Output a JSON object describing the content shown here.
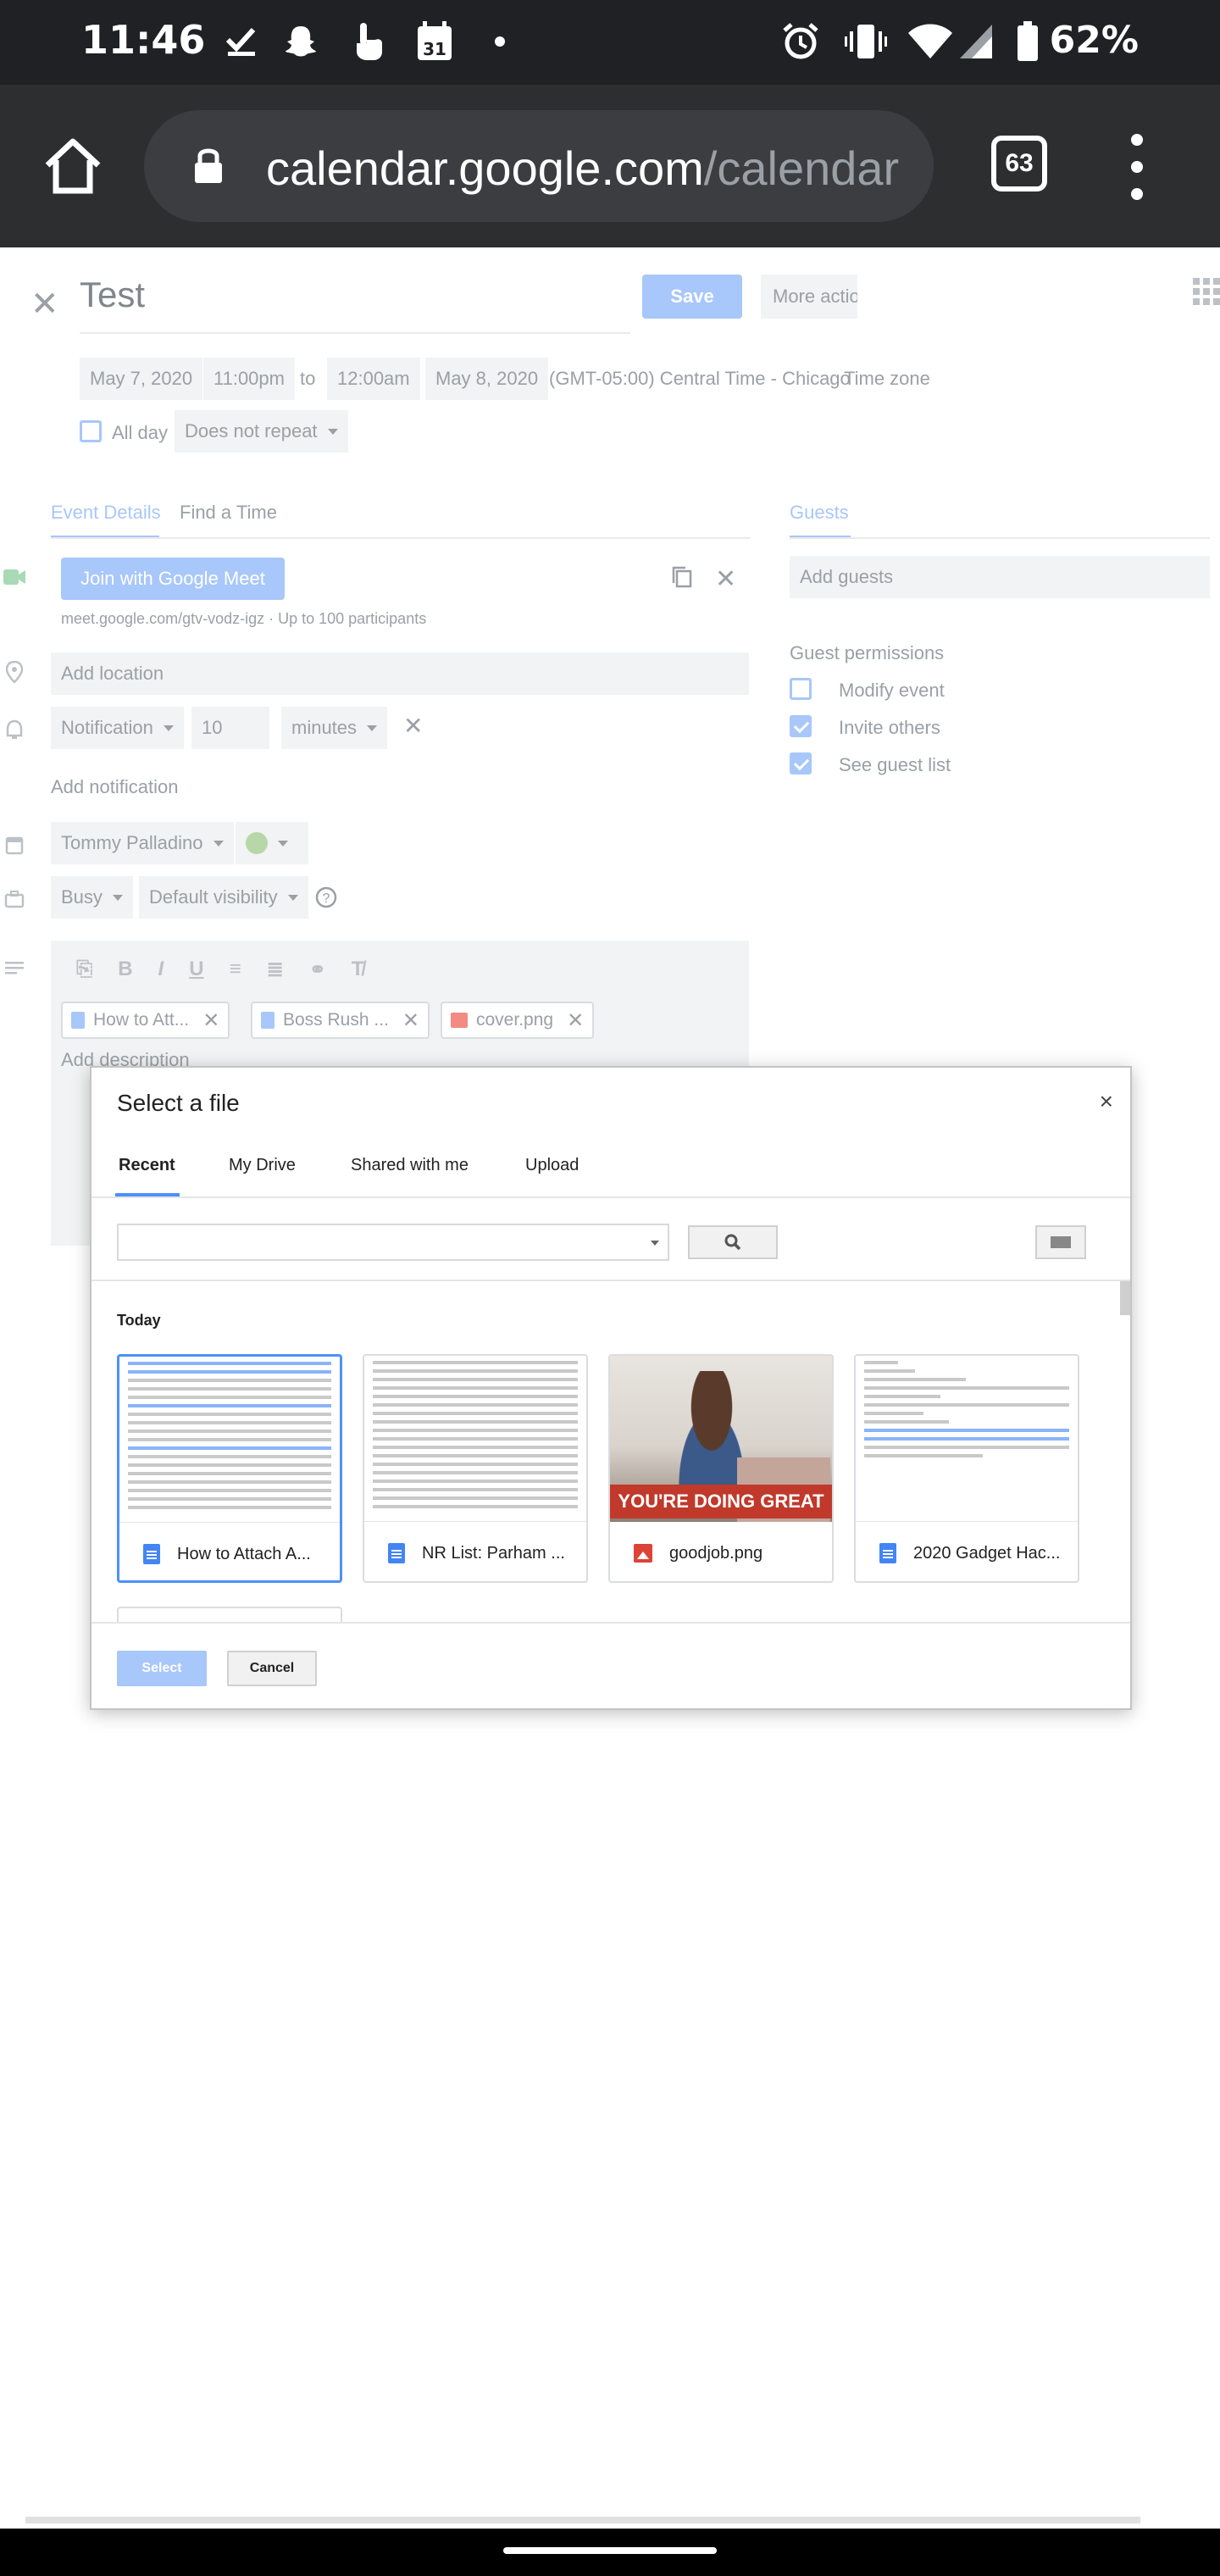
{
  "status_bar": {
    "time": "11:46",
    "battery": "62%",
    "tabs_count": "63",
    "calendar_icon_date": "31"
  },
  "browser": {
    "url_main": "calendar.google.com",
    "url_path": "/calendar"
  },
  "event": {
    "title": "Test",
    "save_label": "Save",
    "more_label": "More actio",
    "start_date": "May 7, 2020",
    "start_time": "11:00pm",
    "to_label": "to",
    "end_time": "12:00am",
    "end_date": "May 8, 2020",
    "timezone_value": "(GMT-05:00) Central Time - Chicago",
    "timezone_label": "Time zone",
    "all_day_label": "All day",
    "repeat_value": "Does not repeat",
    "tab_details": "Event Details",
    "tab_find_time": "Find a Time",
    "meet_button": "Join with Google Meet",
    "meet_link": "meet.google.com/gtv-vodz-igz · Up to 100 participants",
    "location_placeholder": "Add location",
    "notification_type": "Notification",
    "notification_value": "10",
    "notification_unit": "minutes",
    "add_notification": "Add notification",
    "calendar_owner": "Tommy Palladino",
    "busy_value": "Busy",
    "visibility_value": "Default visibility",
    "attachments": [
      {
        "name": "How to Att..."
      },
      {
        "name": "Boss Rush ..."
      },
      {
        "name": "cover.png"
      }
    ],
    "description_placeholder": "Add description"
  },
  "guests": {
    "tab_label": "Guests",
    "add_placeholder": "Add guests",
    "permissions_title": "Guest permissions",
    "permissions": [
      {
        "label": "Modify event",
        "checked": false
      },
      {
        "label": "Invite others",
        "checked": true
      },
      {
        "label": "See guest list",
        "checked": true
      }
    ]
  },
  "picker": {
    "title": "Select a file",
    "close": "×",
    "tabs": [
      "Recent",
      "My Drive",
      "Shared with me",
      "Upload"
    ],
    "section": "Today",
    "files": [
      {
        "name": "How to Attach A...",
        "type": "doc"
      },
      {
        "name": "NR List: Parham ...",
        "type": "doc"
      },
      {
        "name": "goodjob.png",
        "type": "image",
        "image_text": "YOU'RE DOING GREAT"
      },
      {
        "name": "2020 Gadget Hac...",
        "type": "doc"
      }
    ],
    "select_label": "Select",
    "cancel_label": "Cancel"
  },
  "colors": {
    "accent_blue": "#4d90fe",
    "disabled_blue": "#a8c7fa",
    "status_bar": "#202124",
    "toolbar": "#2d2e30"
  }
}
